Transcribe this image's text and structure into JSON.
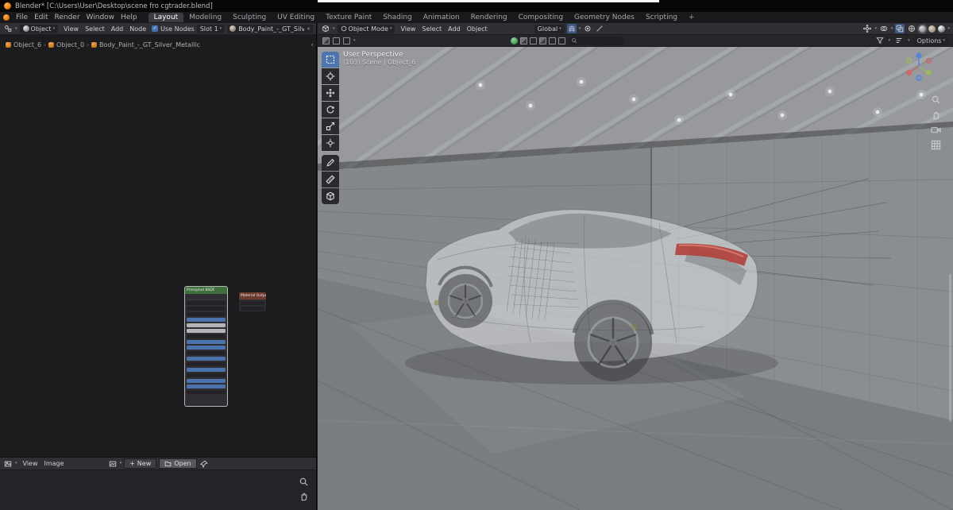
{
  "window": {
    "title": "Blender* [C:\\Users\\User\\Desktop\\scene fro cgtrader.blend]"
  },
  "menubar": {
    "app_menus": [
      "File",
      "Edit",
      "Render",
      "Window",
      "Help"
    ],
    "workspaces": [
      "Layout",
      "Modeling",
      "Sculpting",
      "UV Editing",
      "Texture Paint",
      "Shading",
      "Animation",
      "Rendering",
      "Compositing",
      "Geometry Nodes",
      "Scripting"
    ],
    "active_workspace": "Layout",
    "add_workspace_label": "+"
  },
  "shader_editor": {
    "header": {
      "mode": "Object",
      "menus": [
        "View",
        "Select",
        "Add",
        "Node"
      ],
      "use_nodes_label": "Use Nodes",
      "slot_label": "Slot 1",
      "material_name": "Body_Paint_-_GT_Silver_M"
    },
    "breadcrumb": {
      "items": [
        "Object_6",
        "Object_0",
        "Body_Paint_-_GT_Silver_Metallic"
      ]
    },
    "nodes": {
      "principled": {
        "title": "Principled BSDF",
        "rows": [
          "label",
          "value",
          "value",
          "value",
          "blue",
          "light",
          "light",
          "value",
          "blue",
          "blue",
          "value",
          "blue",
          "value",
          "blue",
          "value",
          "blue",
          "blue",
          "value"
        ]
      },
      "output": {
        "title": "Material Output",
        "rows": [
          "value",
          "value"
        ]
      }
    }
  },
  "viewport": {
    "header": {
      "mode": "Object Mode",
      "menus": [
        "View",
        "Select",
        "Add",
        "Object"
      ],
      "orientation": "Global"
    },
    "toolsettings": {
      "options_label": "Options"
    },
    "overlay": {
      "line1": "User Perspective",
      "line2": "(103) Scene | Object_6"
    },
    "tools": [
      "select-box",
      "cursor",
      "move",
      "rotate",
      "scale",
      "transform",
      "annotate",
      "measure",
      "add-cube"
    ],
    "active_tool": "select-box"
  },
  "image_editor": {
    "menus": [
      "View",
      "Image"
    ],
    "new_label": "New",
    "open_label": "Open"
  },
  "icons": {
    "chevron_down": "▾",
    "checkmark": "✓",
    "close": "✕",
    "plus": "+",
    "collapse_left": "‹",
    "breadcrumb_sep": "›"
  },
  "colors": {
    "accent": "#4772b3",
    "node_header_shader": "#3d703d",
    "node_header_output": "#6e3b2e",
    "taillight": "#b04038"
  }
}
